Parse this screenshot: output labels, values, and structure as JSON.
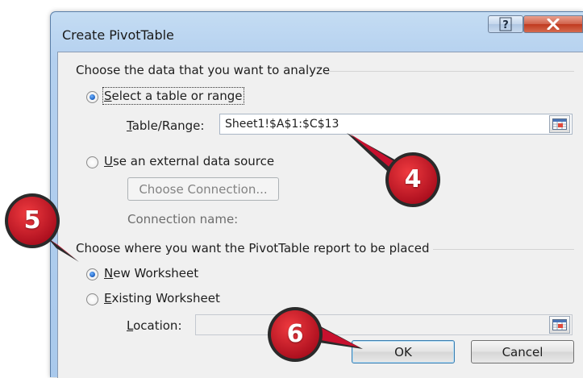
{
  "dialog": {
    "title": "Create PivotTable",
    "help_button": "?",
    "close_button": "X"
  },
  "analyze_group": {
    "label": "Choose the data that you want to analyze",
    "select_range": {
      "prefix": "",
      "mnemonic": "S",
      "rest": "elect a table or range",
      "checked": true
    },
    "table_range": {
      "mnemonic": "T",
      "rest": "able/Range:",
      "value": "Sheet1!$A$1:$C$13"
    },
    "external_source": {
      "mnemonic": "U",
      "rest": "se an external data source",
      "checked": false
    },
    "choose_connection": "Choose Connection...",
    "connection_name": "Connection name:"
  },
  "placement_group": {
    "label": "Choose where you want the PivotTable report to be placed",
    "new_worksheet": {
      "mnemonic": "N",
      "rest": "ew Worksheet",
      "checked": true
    },
    "existing_worksheet": {
      "mnemonic": "E",
      "rest": "xisting Worksheet",
      "checked": false
    },
    "location": {
      "mnemonic": "L",
      "rest": "ocation:",
      "value": ""
    }
  },
  "buttons": {
    "ok": "OK",
    "cancel": "Cancel"
  },
  "callouts": [
    {
      "number": "4"
    },
    {
      "number": "5"
    },
    {
      "number": "6"
    }
  ],
  "colors": {
    "callout": "#c8102e",
    "callout_ring": "#2a2a2a",
    "title_bar": "#b4d0ef",
    "close": "#c0391f"
  },
  "icons": {
    "help": "question-icon",
    "close": "close-icon",
    "range_picker": "range-picker-icon"
  }
}
